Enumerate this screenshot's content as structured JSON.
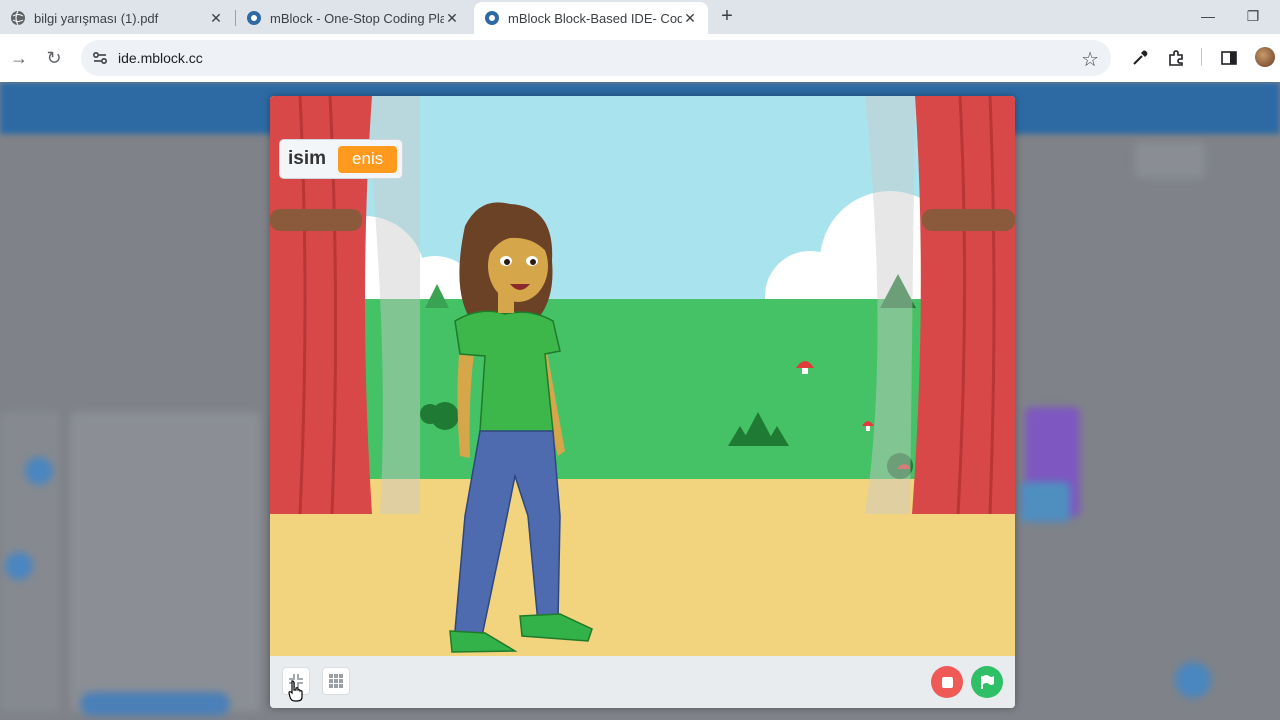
{
  "browser": {
    "tabs": [
      {
        "title": "bilgi yarışması (1).pdf",
        "active": false
      },
      {
        "title": "mBlock - One-Stop Coding Platform",
        "active": false
      },
      {
        "title": "mBlock Block-Based IDE- Coding",
        "active": true
      }
    ],
    "new_tab_glyph": "+",
    "close_glyph": "✕",
    "minimize_glyph": "—",
    "restore_glyph": "❐",
    "address": "ide.mblock.cc",
    "back_glyph": "→",
    "reload_glyph": "↻",
    "star_glyph": "☆"
  },
  "stage": {
    "monitor": {
      "label": "isim",
      "value": "enis"
    },
    "colors": {
      "sky": "#a9e4ee",
      "grass": "#45c266",
      "floor": "#f2d37e",
      "curtain": "#d84848",
      "monitor_value": "#ff9a1e"
    },
    "controls": {
      "small_stage_icon": "resize-icon",
      "grid_icon": "grid-icon",
      "stop_icon": "stop-icon",
      "go_icon": "green-flag-icon"
    }
  }
}
